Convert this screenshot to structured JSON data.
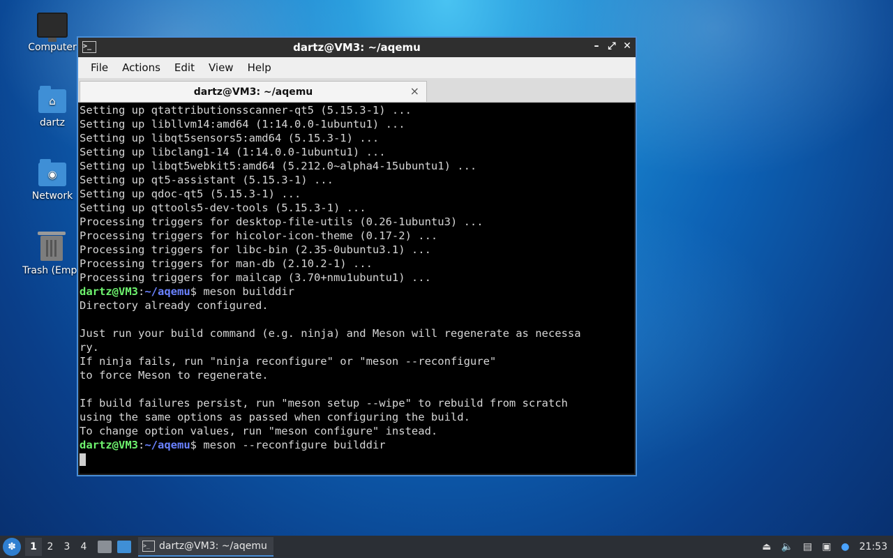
{
  "desktop": {
    "icons": [
      {
        "label": "Computer"
      },
      {
        "label": "dartz"
      },
      {
        "label": "Network"
      },
      {
        "label": "Trash (Empt"
      }
    ]
  },
  "window": {
    "title": "dartz@VM3: ~/aqemu",
    "controls": {
      "minimize": "–",
      "maximize": "⤢",
      "close": "✕"
    },
    "menu": [
      "File",
      "Actions",
      "Edit",
      "View",
      "Help"
    ],
    "tab": {
      "label": "dartz@VM3: ~/aqemu",
      "close": "×"
    }
  },
  "terminal": {
    "lines": [
      "Setting up qtattributionsscanner-qt5 (5.15.3-1) ...",
      "Setting up libllvm14:amd64 (1:14.0.0-1ubuntu1) ...",
      "Setting up libqt5sensors5:amd64 (5.15.3-1) ...",
      "Setting up libclang1-14 (1:14.0.0-1ubuntu1) ...",
      "Setting up libqt5webkit5:amd64 (5.212.0~alpha4-15ubuntu1) ...",
      "Setting up qt5-assistant (5.15.3-1) ...",
      "Setting up qdoc-qt5 (5.15.3-1) ...",
      "Setting up qttools5-dev-tools (5.15.3-1) ...",
      "Processing triggers for desktop-file-utils (0.26-1ubuntu3) ...",
      "Processing triggers for hicolor-icon-theme (0.17-2) ...",
      "Processing triggers for libc-bin (2.35-0ubuntu3.1) ...",
      "Processing triggers for man-db (2.10.2-1) ...",
      "Processing triggers for mailcap (3.70+nmu1ubuntu1) ..."
    ],
    "prompt_user": "dartz@VM3",
    "prompt_sep": ":",
    "prompt_path": "~/aqemu",
    "prompt_end": "$ ",
    "cmd1": "meson builddir",
    "output": [
      "Directory already configured.",
      "",
      "Just run your build command (e.g. ninja) and Meson will regenerate as necessa",
      "ry.",
      "If ninja fails, run \"ninja reconfigure\" or \"meson --reconfigure\"",
      "to force Meson to regenerate.",
      "",
      "If build failures persist, run \"meson setup --wipe\" to rebuild from scratch",
      "using the same options as passed when configuring the build.",
      "To change option values, run \"meson configure\" instead."
    ],
    "cmd2": "meson --reconfigure builddir"
  },
  "taskbar": {
    "workspaces": [
      "1",
      "2",
      "3",
      "4"
    ],
    "task_label": "dartz@VM3: ~/aqemu",
    "clock": "21:53"
  }
}
